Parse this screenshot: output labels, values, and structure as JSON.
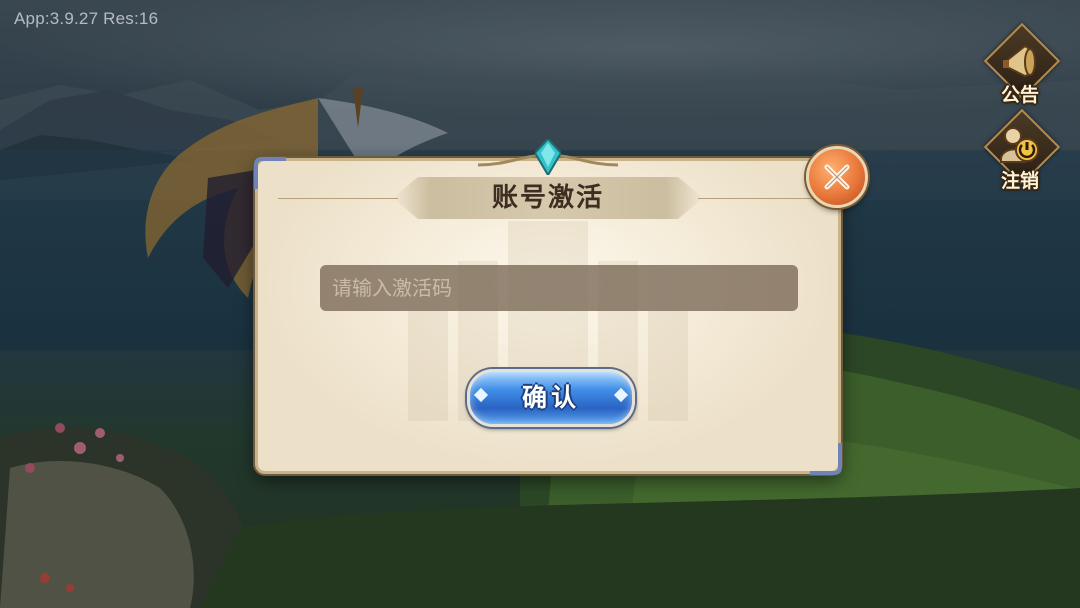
{
  "hud": {
    "version": "App:3.9.27 Res:16"
  },
  "side_buttons": {
    "notice_label": "公告",
    "logout_label": "注销"
  },
  "dialog": {
    "title": "账号激活",
    "input_placeholder": "请输入激活码",
    "input_value": "",
    "confirm_label": "确认"
  },
  "colors": {
    "dialog_bg": "#ede1c9",
    "input_bg": "#786655",
    "confirm_blue": "#3f8de6",
    "close_orange": "#e8773a"
  },
  "icons": {
    "notice": "horn-icon",
    "logout": "power-icon",
    "close": "close-icon",
    "gem": "gem-icon"
  }
}
